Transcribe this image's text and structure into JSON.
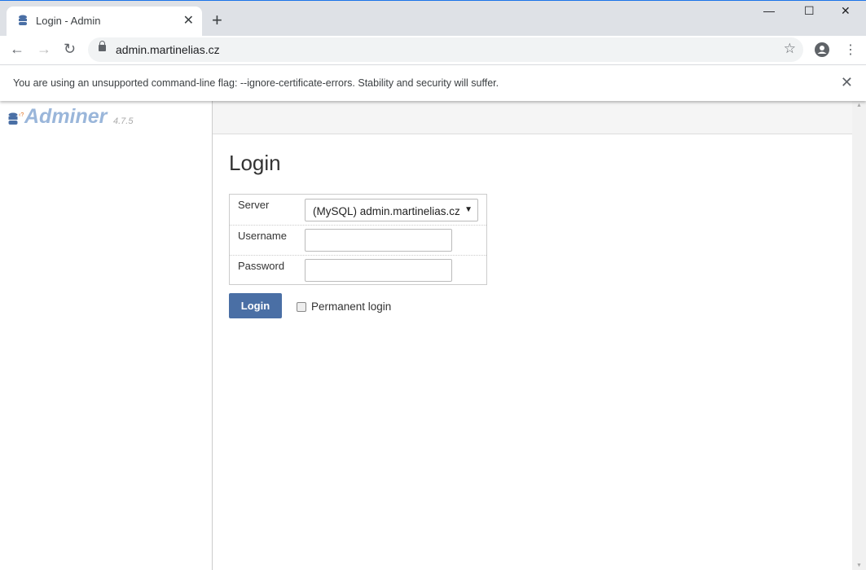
{
  "browser": {
    "tab_title": "Login - Admin",
    "url": "admin.martinelias.cz",
    "infobar": "You are using an unsupported command-line flag: --ignore-certificate-errors. Stability and security will suffer."
  },
  "sidebar": {
    "logo": "Adminer",
    "version": "4.7.5"
  },
  "main": {
    "title": "Login",
    "server_label": "Server",
    "server_value": "(MySQL) admin.martinelias.cz",
    "username_label": "Username",
    "username_value": "",
    "password_label": "Password",
    "password_value": "",
    "login_button": "Login",
    "permanent_login": "Permanent login",
    "permanent_checked": false
  },
  "colors": {
    "accent": "#4a6fa5",
    "logo": "#9ab6da"
  }
}
